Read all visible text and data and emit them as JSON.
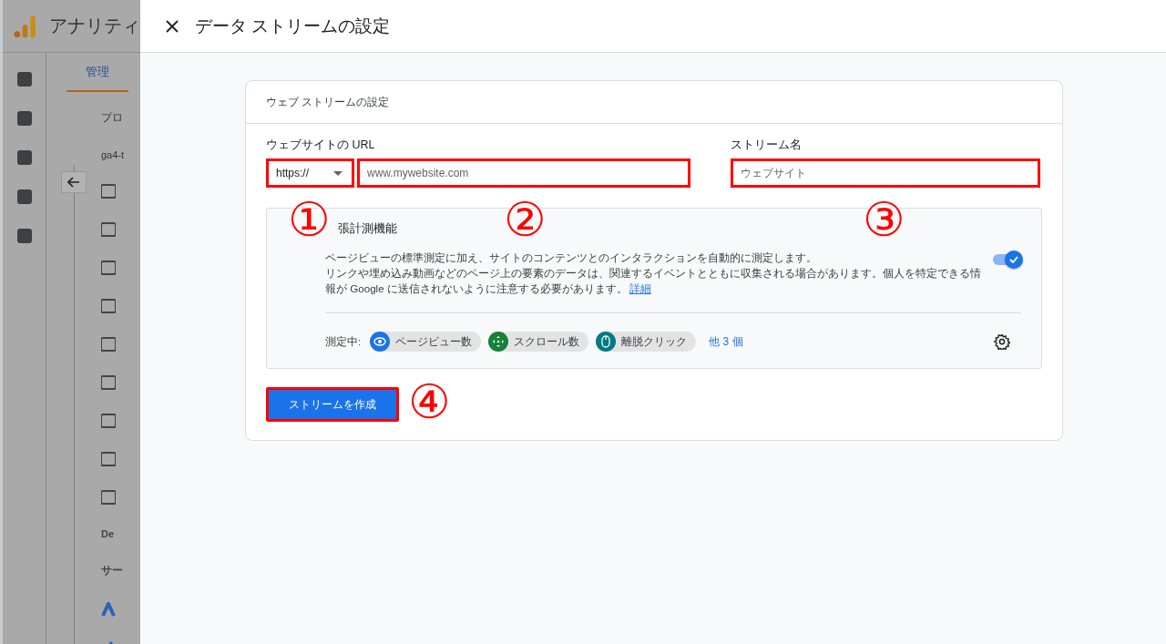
{
  "backdrop": {
    "app_title": "アナリティ",
    "tab": {
      "label": "管理",
      "selected": true
    },
    "column_labels": [
      "プロ",
      "ga4-t"
    ],
    "truncated_items": [
      "De",
      "サー"
    ]
  },
  "dialog": {
    "title": "データ ストリームの設定"
  },
  "card": {
    "title": "ウェブ ストリームの設定",
    "url": {
      "label": "ウェブサイトの URL",
      "protocol": "https://",
      "placeholder": "www.mywebsite.com",
      "protocol_highlighted": true,
      "highlighted": true
    },
    "stream_name": {
      "label": "ストリーム名",
      "placeholder": "ウェブサイト",
      "highlighted": true
    },
    "enhanced": {
      "title": "張計測機能",
      "description": [
        "ページビューの標準測定に加え、サイトのコンテンツとのインタラクションを自動的に測定します。",
        "リンクや埋め込み動画などのページ上の要素のデータは、関連するイベントとともに収集される場合があります。個人を特定できる情報が Google に送信されないように注意する必要があります。"
      ],
      "link": "詳細",
      "on": true,
      "measuring_label": "測定中:",
      "events": [
        {
          "label": "ページビュー数",
          "color": "#1a73e8",
          "kind": "eye"
        },
        {
          "label": "スクロール数",
          "color": "#188038",
          "kind": "scroll"
        },
        {
          "label": "離脱クリック",
          "color": "#007b83",
          "kind": "mouse"
        }
      ],
      "more": "他 3 個"
    },
    "create_button": {
      "label": "ストリームを作成",
      "highlighted": true
    }
  },
  "annotations": [
    {
      "label": "①"
    },
    {
      "label": "②"
    },
    {
      "label": "③"
    },
    {
      "label": "④"
    }
  ]
}
